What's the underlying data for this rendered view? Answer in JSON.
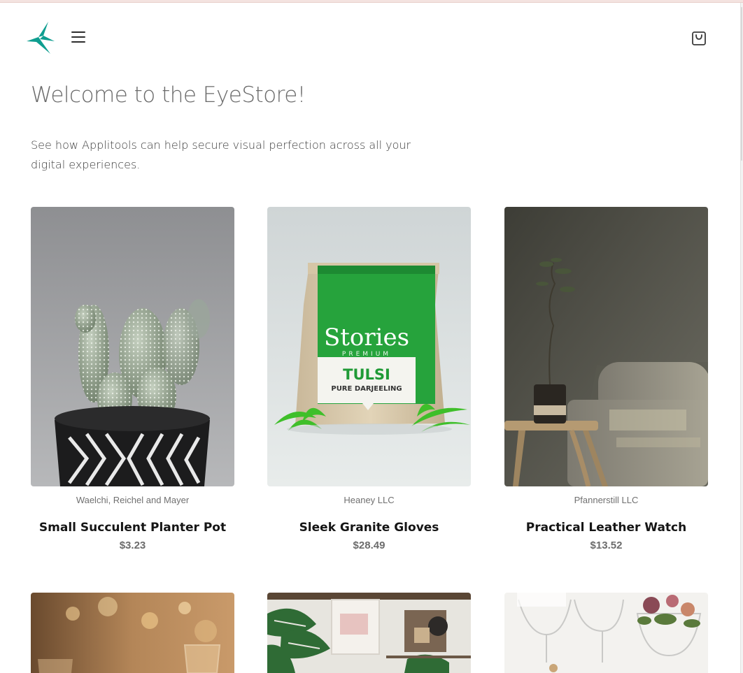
{
  "app": {
    "name": "EyeStore"
  },
  "header": {
    "logo_icon": "applitools-star-logo-icon",
    "menu_icon": "hamburger-menu-icon",
    "cart_icon": "shopping-bag-icon",
    "accent_color": "#0f9e90"
  },
  "main": {
    "title": "Welcome to the EyeStore!",
    "intro": "See how Applitools can help secure visual perfection across all your digital experiences."
  },
  "products": [
    {
      "vendor": "Waelchi, Reichel and Mayer",
      "name": "Small Succulent Planter Pot",
      "price": "$3.23",
      "image_icon": "cactus-pot-image"
    },
    {
      "vendor": "Heaney LLC",
      "name": "Sleek Granite Gloves",
      "price": "$28.49",
      "image_icon": "tea-bag-image",
      "image_text": {
        "brand": "Stories",
        "sub": "PREMIUM",
        "product": "TULSI",
        "variant": "PURE DARJEELING"
      }
    },
    {
      "vendor": "Pfannerstill LLC",
      "name": "Practical Leather Watch",
      "price": "$13.52",
      "image_icon": "plant-and-sofa-image"
    }
  ],
  "products_row2": [
    {
      "image_icon": "candle-glasses-image"
    },
    {
      "image_icon": "monstera-room-image"
    },
    {
      "image_icon": "wine-glasses-flowers-image"
    }
  ]
}
